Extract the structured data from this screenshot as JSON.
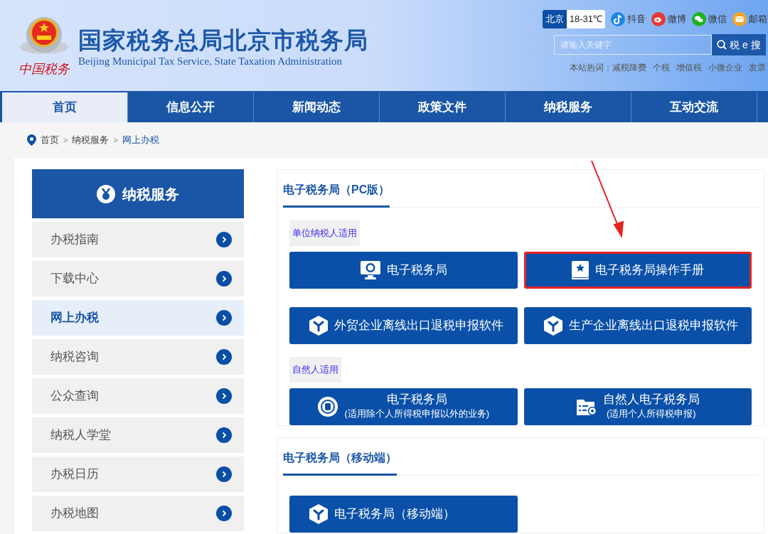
{
  "header": {
    "title": "国家税务总局北京市税务局",
    "subtitle": "Beijing Municipal Tax Service, State Taxation Administration",
    "logo_caption": "中国税务",
    "weather": {
      "city": "北京",
      "temperature": "18-31℃"
    },
    "social": [
      {
        "kind": "douyin",
        "label": "抖音",
        "color": "#1e88e5"
      },
      {
        "kind": "weibo",
        "label": "微博",
        "color": "#e53935"
      },
      {
        "kind": "wechat",
        "label": "微信",
        "color": "#1db31d"
      },
      {
        "kind": "mail",
        "label": "邮箱",
        "color": "#f5a623"
      }
    ],
    "search": {
      "placeholder": "请输入关键字",
      "button": "税 e 搜"
    },
    "hot_words": {
      "label": "本站热词：",
      "items": [
        "减税降费",
        "个税",
        "增值税",
        "小微企业",
        "发票"
      ]
    }
  },
  "nav": [
    {
      "label": "首页",
      "selected": true
    },
    {
      "label": "信息公开",
      "selected": false
    },
    {
      "label": "新闻动态",
      "selected": false
    },
    {
      "label": "政策文件",
      "selected": false
    },
    {
      "label": "纳税服务",
      "selected": false
    },
    {
      "label": "互动交流",
      "selected": false
    }
  ],
  "breadcrumb": {
    "separator": ">",
    "items": [
      "首页",
      "纳税服务",
      "网上办税"
    ]
  },
  "sidebar": {
    "title": "纳税服务",
    "items": [
      {
        "label": "办税指南",
        "selected": false
      },
      {
        "label": "下载中心",
        "selected": false
      },
      {
        "label": "网上办税",
        "selected": true
      },
      {
        "label": "纳税咨询",
        "selected": false
      },
      {
        "label": "公众查询",
        "selected": false
      },
      {
        "label": "纳税人学堂",
        "selected": false
      },
      {
        "label": "办税日历",
        "selected": false
      },
      {
        "label": "办税地图",
        "selected": false
      }
    ]
  },
  "sections": [
    {
      "title": "电子税务局（PC版）",
      "groups": [
        {
          "tag": "单位纳税人适用",
          "buttons": [
            {
              "kind": "monitor",
              "label": "电子税务局",
              "highlighted": false
            },
            {
              "kind": "book",
              "label": "电子税务局操作手册",
              "highlighted": true
            },
            {
              "kind": "cube",
              "label": "外贸企业离线出口退税申报软件",
              "highlighted": false
            },
            {
              "kind": "cube",
              "label": "生产企业离线出口退税申报软件",
              "highlighted": false
            }
          ]
        },
        {
          "tag": "自然人适用",
          "buttons": [
            {
              "kind": "emblem",
              "label": "电子税务局",
              "note": "(适用除个人所得税申报以外的业务)",
              "highlighted": false
            },
            {
              "kind": "folder",
              "label": "自然人电子税务局",
              "note": "(适用个人所得税申报)",
              "highlighted": false
            }
          ]
        }
      ]
    },
    {
      "title": "电子税务局（移动端）",
      "groups": [
        {
          "buttons": [
            {
              "kind": "cube",
              "label": "电子税务局（移动端）",
              "highlighted": false
            }
          ]
        }
      ]
    }
  ]
}
